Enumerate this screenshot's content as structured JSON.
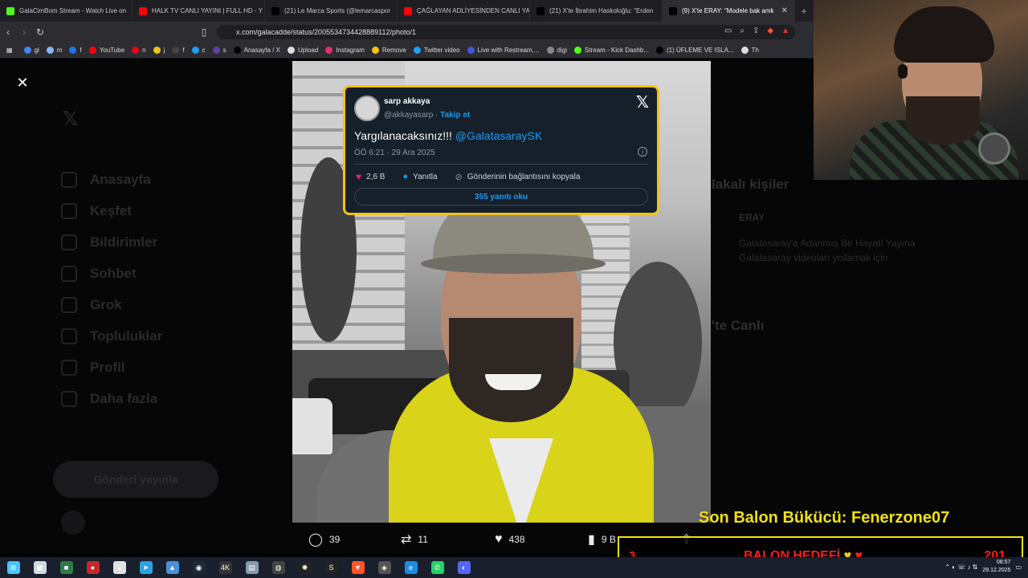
{
  "browser": {
    "tabs": [
      {
        "title": "GalaCimBom Stream - Watch Live on",
        "icon": "kick-icon",
        "color": "#53fc18"
      },
      {
        "title": "HALK TV CANLI YAYINI | FULL HD - Y",
        "icon": "youtube-icon",
        "color": "#ff0000"
      },
      {
        "title": "(21) Le Marca Sports (@lemarcaspor",
        "icon": "x-icon",
        "color": "#000000"
      },
      {
        "title": "ÇAĞLAYAN ADLİYESİNDEN CANLI YA",
        "icon": "youtube-icon",
        "color": "#ff0000"
      },
      {
        "title": "(21) X'te İbrahim Haskoloğlu: \"Erden",
        "icon": "x-icon",
        "color": "#000000"
      },
      {
        "title": "(9) X'te ERAY: \"Modele bak amk",
        "icon": "x-icon",
        "color": "#000000",
        "active": true
      }
    ],
    "url": "x.com/galacadde/status/2005534734428889112/photo/1",
    "bookmarks": [
      {
        "label": "gl",
        "color": "#4285f4"
      },
      {
        "label": "m",
        "color": "#8ab4f8"
      },
      {
        "label": "f",
        "color": "#1877f2"
      },
      {
        "label": "YouTube",
        "color": "#ff0000"
      },
      {
        "label": "n",
        "color": "#e50914"
      },
      {
        "label": "j",
        "color": "#f2c21b"
      },
      {
        "label": "f",
        "color": "#444444"
      },
      {
        "label": "c",
        "color": "#1da1f2"
      },
      {
        "label": "s",
        "color": "#6441a5"
      },
      {
        "label": "Anasayfa / X",
        "color": "#000000"
      },
      {
        "label": "Upload",
        "color": "#dddddd"
      },
      {
        "label": "Instagram",
        "color": "#e1306c"
      },
      {
        "label": "Remove",
        "color": "#f2c21b"
      },
      {
        "label": "Twitter video",
        "color": "#1da1f2"
      },
      {
        "label": "Live with Restream,...",
        "color": "#3b5bdb"
      },
      {
        "label": "digi",
        "color": "#888888"
      },
      {
        "label": "Stream - Kick Dashb...",
        "color": "#53fc18"
      },
      {
        "label": "(1) ÜFLEME VE ISLA...",
        "color": "#000000"
      },
      {
        "label": "Th",
        "color": "#dddddd"
      }
    ]
  },
  "sidebar": {
    "items": [
      "Anasayfa",
      "Keşfet",
      "Bildirimler",
      "Sohbet",
      "Grok",
      "Topluluklar",
      "Profil",
      "Daha fazla"
    ],
    "post_button": "Gönderi yayınla"
  },
  "right_panel": {
    "relevant_heading": "lakalı kişiler",
    "relevant_user": "ERAY",
    "bio": "Galatasaray'a Adanmış Bir Hayat! Yayına Galatasaray videoları yollamak için",
    "live_heading": "'te Canlı"
  },
  "tweet": {
    "name": "sarp akkaya",
    "handle": "@akkayasarp",
    "separator": "·",
    "follow": "Takip et",
    "text": "Yargılanacaksınız!!! ",
    "mention": "@GalatasaraySK",
    "date": "ÖÖ 6:21 · 29 Ara 2025",
    "likes": "2,6 B",
    "reply": "Yanıtla",
    "copy_link": "Gönderinin bağlantısını kopyala",
    "read_replies": "355 yanıtı oku"
  },
  "photo_actions": {
    "replies": "39",
    "reposts": "11",
    "likes": "438",
    "views": "9 B"
  },
  "overlay": {
    "banner": "Son Balon Bükücü: Fenerzone07",
    "goal_left": "3",
    "goal_title": "BALON HEDEFİ",
    "goal_right": "201"
  },
  "taskbar": {
    "time": "08:57",
    "date": "29.12.2025"
  },
  "colors": {
    "accent": "#1d9bf0",
    "highlight": "#f2c21b",
    "like": "#f91880",
    "goal": "#ff1a1a"
  }
}
